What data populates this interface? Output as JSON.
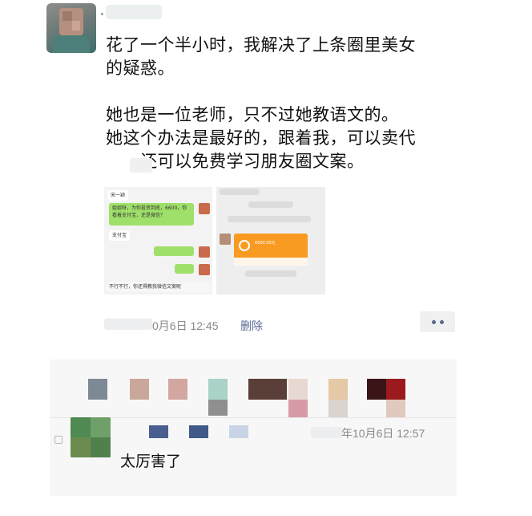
{
  "post": {
    "text": "花了一个半小时，我解决了上条圈里美女\n的疑惑。\n\n她也是一位老师，只不过她教语文的。\n她这个办法是最好的，跟着我，可以卖代\n      还可以免费学习朋友圈文案。",
    "screenshot_left": {
      "header": "宋一颖",
      "msg1": "姐姐呀，为你投资到底，6600，你看着支付宝，还是微信？",
      "msg2": "支付宝",
      "bottom": "不行不行，你还得教我微信文案呢"
    },
    "screenshot_right": {
      "card_amount": "6600.00元"
    }
  },
  "meta": {
    "time": "0月6日 12:45",
    "delete_label": "删除"
  },
  "comment": {
    "time": "年10月6日 12:57",
    "text": "太厉害了"
  },
  "colors": {
    "link": "#576b95",
    "time": "#8a8a8a",
    "chat_green": "#9fe06a",
    "card_orange": "#f99a22"
  },
  "icons": [
    "more-dots-icon",
    "comment-icon"
  ]
}
